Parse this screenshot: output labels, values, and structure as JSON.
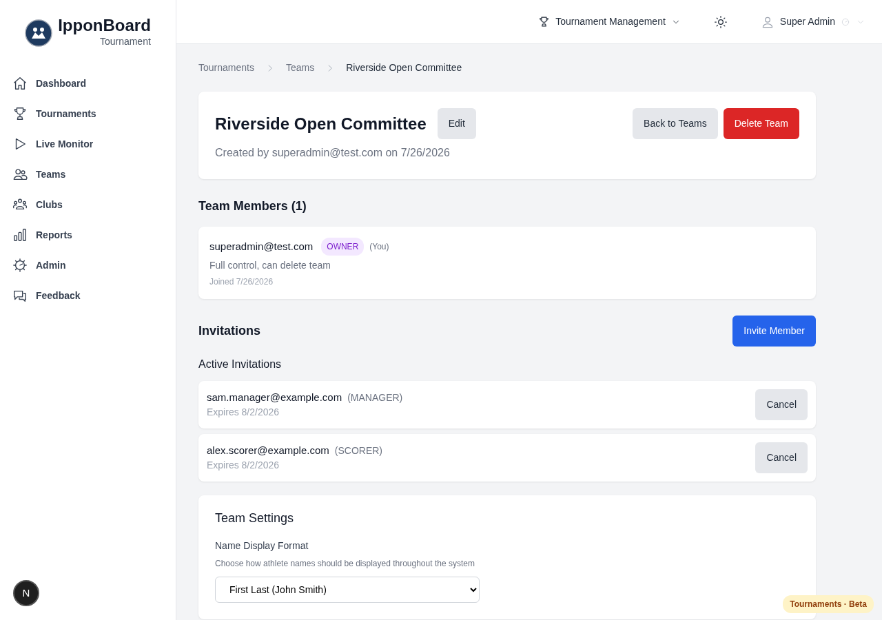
{
  "brand": {
    "name": "IpponBoard",
    "subtitle": "Tournament"
  },
  "sidebar": {
    "items": [
      {
        "label": "Dashboard"
      },
      {
        "label": "Tournaments"
      },
      {
        "label": "Live Monitor"
      },
      {
        "label": "Teams"
      },
      {
        "label": "Clubs"
      },
      {
        "label": "Reports"
      },
      {
        "label": "Admin"
      },
      {
        "label": "Feedback"
      }
    ]
  },
  "topbar": {
    "menu": "Tournament Management",
    "user": "Super Admin"
  },
  "breadcrumb": [
    "Tournaments",
    "Teams",
    "Riverside Open Committee"
  ],
  "team": {
    "name": "Riverside Open Committee",
    "edit": "Edit",
    "created": "Created by superadmin@test.com on 7/26/2026",
    "back": "Back to Teams",
    "delete": "Delete Team"
  },
  "members": {
    "title": "Team Members (1)",
    "items": [
      {
        "email": "superadmin@test.com",
        "role": "OWNER",
        "you": "(You)",
        "description": "Full control, can delete team",
        "joined": "Joined 7/26/2026"
      }
    ]
  },
  "invitations": {
    "title": "Invitations",
    "invite": "Invite Member",
    "subtitle": "Active Invitations",
    "items": [
      {
        "email": "sam.manager@example.com",
        "role": "(MANAGER)",
        "expires": "Expires 8/2/2026",
        "action": "Cancel"
      },
      {
        "email": "alex.scorer@example.com",
        "role": "(SCORER)",
        "expires": "Expires 8/2/2026",
        "action": "Cancel"
      }
    ]
  },
  "settings": {
    "title": "Team Settings",
    "label": "Name Display Format",
    "help": "Choose how athlete names should be displayed throughout the system",
    "value": "First Last (John Smith)"
  },
  "dev_badge": "N",
  "beta_badge": "Tournaments · Beta"
}
